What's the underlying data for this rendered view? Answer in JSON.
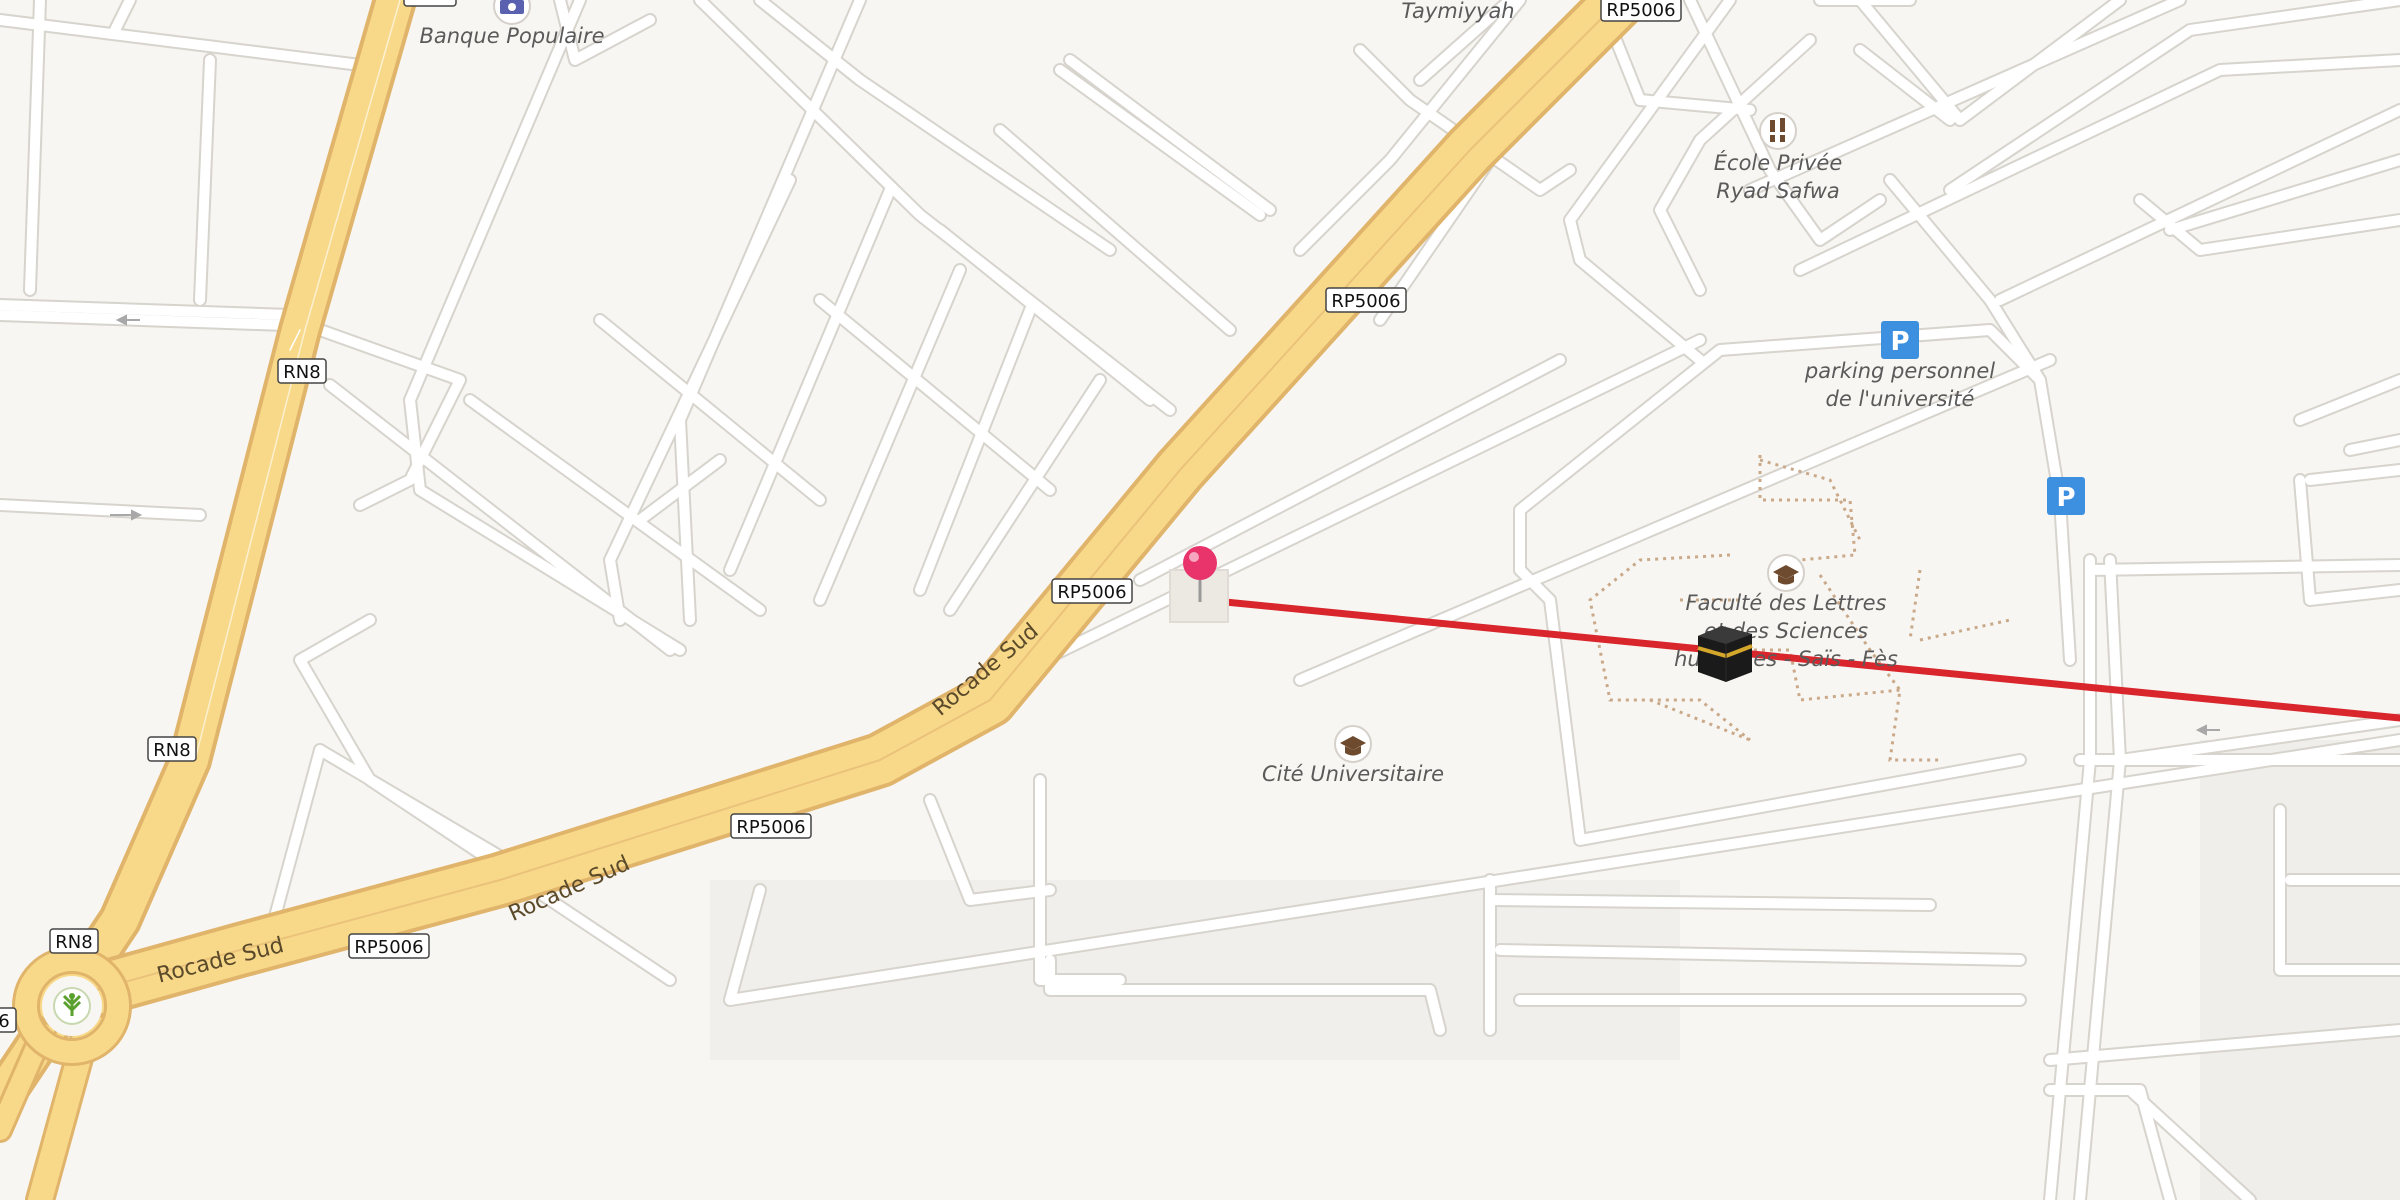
{
  "map": {
    "colors": {
      "land": "#f8f6f2",
      "street_casing": "#d6d2cc",
      "street_fill": "#ffffff",
      "trunk_fill": "#f8d98a",
      "trunk_casing": "#e2b765",
      "route_line": "#d9262c",
      "pin": "#e8336b",
      "parking": "#3d8fe0"
    },
    "road_labels": [
      "Rocade Sud",
      "Rocade Sud",
      "Rocade Sud"
    ],
    "shields": [
      "RP5006",
      "RP5006",
      "RP5006",
      "RP5006",
      "RP5006",
      "RN8",
      "RN8",
      "RN8",
      "6"
    ],
    "places": {
      "banque_populaire": "Banque Populaire",
      "taymiyyah": "Taymiyyah",
      "ecole_line1": "École Privée",
      "ecole_line2": "Ryad Safwa",
      "parking_line1": "parking personnel",
      "parking_line2": "de l'université",
      "faculte_line1": "Faculté des Lettres",
      "faculte_line2": "et des Sciences",
      "faculte_line3": "humaines - Saïs - Fès",
      "cite": "Cité Universitaire"
    },
    "icons": [
      "bank-icon",
      "school-icon",
      "university-icon",
      "parking-icon",
      "kaaba-icon",
      "map-pin-icon",
      "garden-icon"
    ],
    "parking_symbol": "P"
  }
}
